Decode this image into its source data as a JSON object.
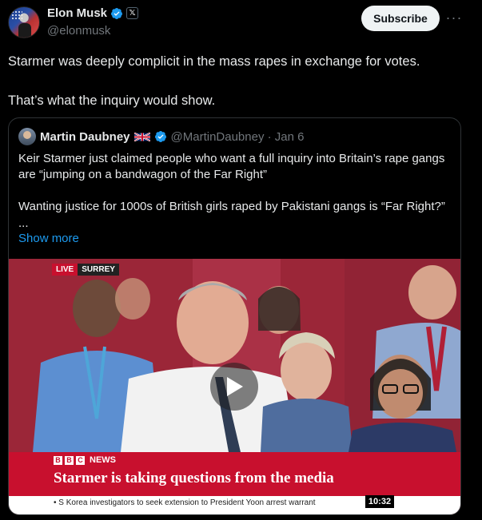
{
  "author": {
    "name": "Elon Musk",
    "handle": "@elonmusk",
    "badge_icon": "x-affiliate-icon"
  },
  "actions": {
    "subscribe_label": "Subscribe",
    "more_label": "···"
  },
  "post": {
    "line1": "Starmer was deeply complicit in the mass rapes in exchange for votes.",
    "line2": "That’s what the inquiry would show."
  },
  "quote": {
    "name": "Martin Daubney",
    "handle_date": "@MartinDaubney · Jan 6",
    "para1": "Keir Starmer just claimed people who want a full inquiry into Britain’s rape gangs are “jumping on a bandwagon of the Far Right”",
    "para2": "Wanting justice for 1000s of British girls raped by Pakistani gangs is “Far Right?”",
    "ellipsis": "...",
    "show_more": "Show more"
  },
  "video": {
    "live_label": "LIVE",
    "location_label": "SURREY",
    "bbc_letters": [
      "B",
      "B",
      "C"
    ],
    "news_label": "NEWS",
    "headline": "Starmer is taking questions from the media",
    "ticker": "• S Korea investigators to seek extension to President Yoon arrest warrant",
    "clock": "10:32"
  },
  "colors": {
    "accent_blue": "#1d9bf0",
    "bbc_red": "#c8102e",
    "background": "#000000"
  }
}
